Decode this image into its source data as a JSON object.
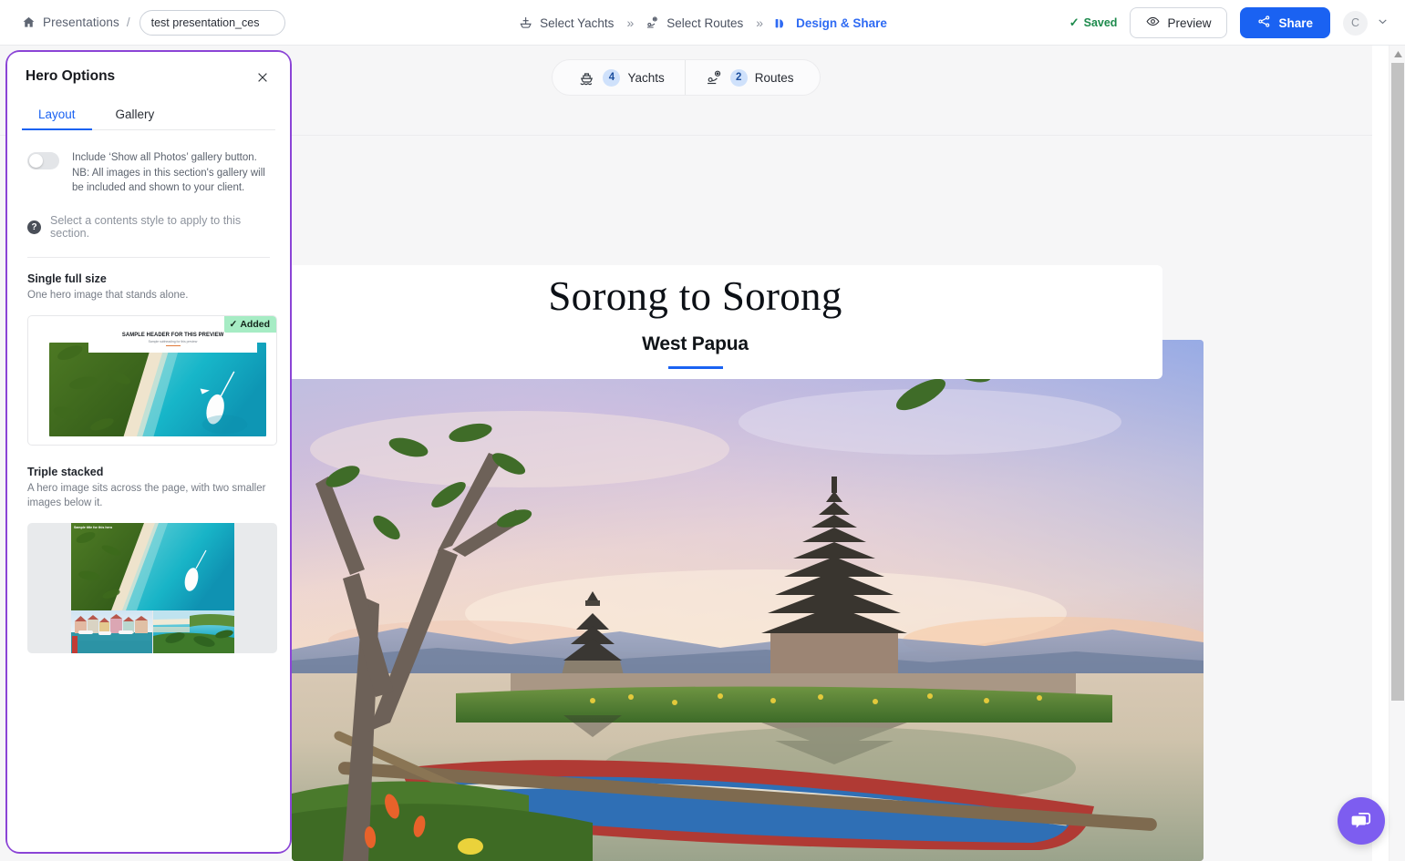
{
  "header": {
    "home_icon": "home-icon",
    "breadcrumb_root": "Presentations",
    "breadcrumb_separator": "/",
    "title_value": "test presentation_ces",
    "title_placeholder": "Presentation name",
    "steps": [
      {
        "label": "Select Yachts",
        "icon": "yacht-icon",
        "active": false
      },
      {
        "label": "Select Routes",
        "icon": "route-pin-icon",
        "active": false
      },
      {
        "label": "Design & Share",
        "icon": "design-share-icon",
        "active": true
      }
    ],
    "step_separator": "»",
    "saved_label": "Saved",
    "saved_tick": "✓",
    "saved_color": "#1d8a4c",
    "preview_label": "Preview",
    "share_label": "Share",
    "share_button_color": "#1a62f2",
    "avatar_initial": "C",
    "account_chevron": "⌄"
  },
  "canvas": {
    "pills": [
      {
        "icon": "yacht-icon",
        "count": "4",
        "label": "Yachts"
      },
      {
        "icon": "route-pin-icon",
        "count": "2",
        "label": "Routes"
      }
    ],
    "hero": {
      "title": "Sorong to Sorong",
      "subtitle": "West Papua",
      "rule_color": "#1a62f2"
    },
    "chat_widget": "chat-bubble-icon",
    "scrollbar": {
      "up_arrow": "▲"
    }
  },
  "panel": {
    "accent_border_color": "#8b44d6",
    "title": "Hero Options",
    "close_icon": "×",
    "tabs": [
      {
        "label": "Layout",
        "active": true
      },
      {
        "label": "Gallery",
        "active": false
      }
    ],
    "toggle": {
      "state": "off",
      "description": "Include ‘Show all Photos’ gallery button. NB: All images in this section's gallery will be included and shown to your client."
    },
    "hint": {
      "icon": "help-question-icon",
      "text": "Select a contents style to apply to this section."
    },
    "options": [
      {
        "name": "Single full size",
        "description": "One hero image that stands alone.",
        "added": true,
        "added_label": "Added",
        "added_tick": "✓",
        "preview_header": "SAMPLE HEADER FOR THIS PREVIEW",
        "preview_subheader": "Sample subheading for this preview"
      },
      {
        "name": "Triple stacked",
        "description": "A hero image sits across the page, with two smaller images below it.",
        "added": false,
        "preview_header": "Sample title for this hero"
      }
    ]
  }
}
